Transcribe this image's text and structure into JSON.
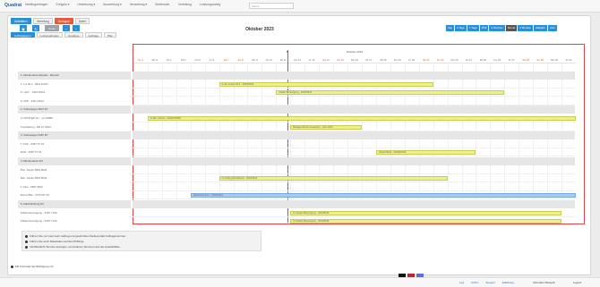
{
  "app": {
    "logo": "Quadrat"
  },
  "topnav": [
    "Meetinganfragen",
    "Ereignis ▾",
    "Umsetzung ▾",
    "Auswertung ▾",
    "Verwaltung ▾",
    "Stellenvatr.",
    "Verteilung",
    "Leistungszweig"
  ],
  "search": {
    "placeholder": "Suche"
  },
  "maintabs": [
    {
      "label": "Aktivitäten",
      "style": "active"
    },
    {
      "label": "Verteilung",
      "style": ""
    },
    {
      "label": "Anfragen",
      "style": "red"
    },
    {
      "label": "Daten",
      "style": ""
    }
  ],
  "subtabs": [
    {
      "label": "Auftragstypen",
      "style": "active"
    },
    {
      "label": "Leistungsbogen",
      "style": ""
    },
    {
      "label": "Vorgänge",
      "style": ""
    },
    {
      "label": "Aufträge",
      "style": ""
    },
    {
      "label": "Plan",
      "style": ""
    }
  ],
  "toolbar": {
    "pdf_label": "Heute",
    "prev": "‹",
    "next": "›"
  },
  "calendar": {
    "title": "Oktober 2023",
    "month_label": "Oktober 2023",
    "today_marker": "▼",
    "days": [
      "So 1",
      "Mo 2",
      "Di 3",
      "Mi 4",
      "Do 5",
      "Fr 6",
      "Sa 7",
      "So 8",
      "Mo 9",
      "Di 10",
      "Mi 11",
      "Do 12",
      "Fr 13",
      "Sa 14",
      "So 15",
      "Mo 16",
      "Di 17",
      "Mi 18",
      "Do 19",
      "Fr 20",
      "Sa 21",
      "So 22",
      "Mo 23",
      "Di 24",
      "Mi 25",
      "Do 26",
      "Fr 27",
      "Sa 28",
      "So 29",
      "Mo 30",
      "Di 31"
    ]
  },
  "views": [
    {
      "label": "Tag",
      "style": ""
    },
    {
      "label": "3 Tage",
      "style": ""
    },
    {
      "label": "7 Tage",
      "style": ""
    },
    {
      "label": "WW",
      "style": ""
    },
    {
      "label": "2 Wochen",
      "style": ""
    },
    {
      "label": "Monat",
      "style": "dark"
    },
    {
      "label": "3 Monate",
      "style": ""
    },
    {
      "label": "Halbjahr",
      "style": ""
    },
    {
      "label": "Jahr",
      "style": ""
    }
  ],
  "rows": [
    {
      "label": "1. Monteurteam Einsatz - Bereich",
      "group": true
    },
    {
      "label": "T. v.d. Ben - 8641 D2S4",
      "group": false
    },
    {
      "label": "Fr. jetzt. - 5119 D2S4",
      "group": false
    },
    {
      "label": "S. KPF - 5111 D2S4",
      "group": false
    },
    {
      "label": "2. Vorbesteger 9547 D7",
      "group": true
    },
    {
      "label": "S. MUSTER-Art. - ps.19880",
      "group": false
    },
    {
      "label": "Topfstellung - M5.47.S2S4",
      "group": false
    },
    {
      "label": "3. Vorbesteger 5487 D7",
      "group": true
    },
    {
      "label": "T. KHF - 5487 T2.S1",
      "group": false
    },
    {
      "label": "EUR - 5487 T2.S1",
      "group": false
    },
    {
      "label": "4. Monteurteam D3",
      "group": true
    },
    {
      "label": "Bun. Kepke 5891 8042",
      "group": false
    },
    {
      "label": "Bun. Kepke 5891 8042",
      "group": false
    },
    {
      "label": "T. Also - 5487 9542",
      "group": false
    },
    {
      "label": "Bund Mitte - 5475 M7 S4",
      "group": false
    },
    {
      "label": "5. Flachdichtung D3",
      "group": true
    },
    {
      "label": "Plattenbereinigung - 5187 T1S3",
      "group": false
    },
    {
      "label": "Plattenbereinigung - 5187 T1S3",
      "group": false
    }
  ],
  "bars": [
    {
      "row": 1,
      "start": 7,
      "end": 21,
      "label": "In der Leiste Vol-1 - 2023/5434",
      "color": "yellow"
    },
    {
      "row": 2,
      "start": 11,
      "end": 26,
      "label": "Urlaub Bereinigung - 2023/5434",
      "color": "yellow"
    },
    {
      "row": 5,
      "start": 2,
      "end": 31,
      "label": "In-Ber. Verbnit - 2023/2435F8",
      "color": "yellow"
    },
    {
      "row": 6,
      "start": 12,
      "end": 16,
      "label": "Beilage Nichten bewertern - Jahr 2023",
      "color": "yellow"
    },
    {
      "row": 9,
      "start": 18,
      "end": 24,
      "label": "Urlaub Binär - 2023/5434F",
      "color": "yellow"
    },
    {
      "row": 12,
      "start": 7,
      "end": 22,
      "label": "In Anfang Wundebrolt - 2023/5434",
      "color": "yellow"
    },
    {
      "row": 14,
      "start": 5,
      "end": 31,
      "label": "Nacharbeit Ann. - 2023/5434",
      "color": "blue"
    },
    {
      "row": 16,
      "start": 12,
      "end": 30,
      "label": "In Verlauf Bereinigung - 2023/5434",
      "color": "yellow"
    },
    {
      "row": 17,
      "start": 12,
      "end": 30,
      "label": "In Verlauf Bereinigung - 2023/5434",
      "color": "yellow"
    }
  ],
  "notes": [
    "Führen Sie zur Liste beim Auftrag und geschnitten Stellevenlatz Auftragsnummer.",
    "Führen Sie auch Materialien auf den Phillings.",
    "Veröffentlicht Termine anzeigen, auf anderen Terminen aus der Auswahlliste."
  ],
  "checkline": "Mit Formular der Befolgung mit",
  "flag_colors": [
    "#111111",
    "#c0262d",
    "#5b6fd6"
  ],
  "footer": {
    "links": [
      "Log",
      "Archiv",
      "Support",
      "Erklärung"
    ],
    "right1": "Abmelden Beispiel",
    "right2": "Logout"
  }
}
